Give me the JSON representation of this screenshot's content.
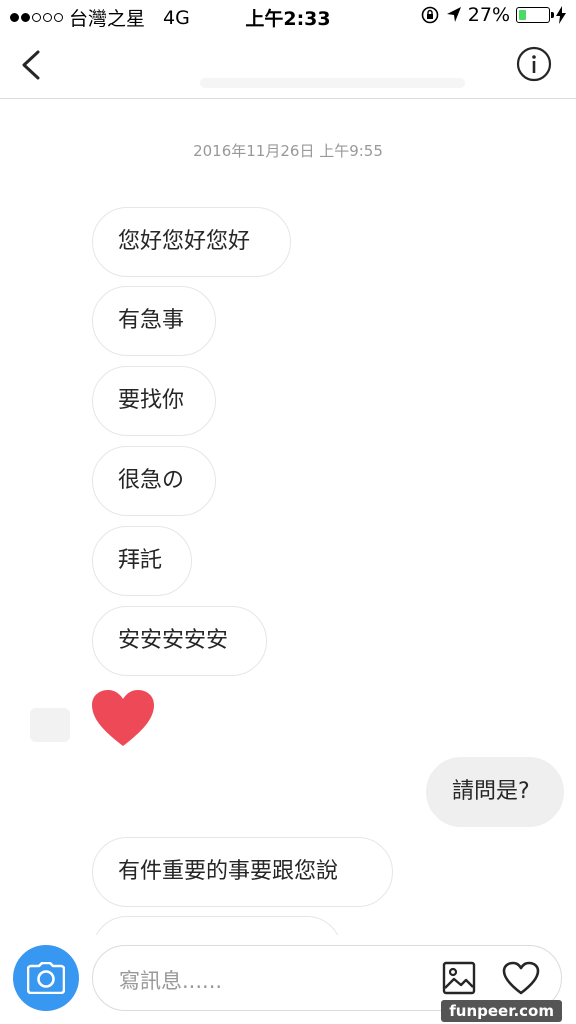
{
  "status_bar": {
    "carrier": "台灣之星",
    "network": "4G",
    "time": "上午2:33",
    "battery_percent": "27%",
    "battery_level": 0.27
  },
  "header": {
    "back_icon": "chevron-left-icon",
    "info_icon": "info-icon"
  },
  "chat": {
    "timestamp": "2016年11月26日 上午9:55",
    "messages": [
      {
        "direction": "incoming",
        "text": "您好您好您好"
      },
      {
        "direction": "incoming",
        "text": "有急事"
      },
      {
        "direction": "incoming",
        "text": "要找你"
      },
      {
        "direction": "incoming",
        "text": "很急の"
      },
      {
        "direction": "incoming",
        "text": "拜託"
      },
      {
        "direction": "incoming",
        "text": "安安安安安"
      },
      {
        "direction": "incoming",
        "type": "heart",
        "color": "#ed4956"
      },
      {
        "direction": "outgoing",
        "text": "請問是?"
      },
      {
        "direction": "incoming",
        "text": "有件重要的事要跟您說"
      }
    ]
  },
  "composer": {
    "placeholder": "寫訊息......",
    "camera_color": "#3897f0"
  },
  "watermark": "funpeer.com"
}
